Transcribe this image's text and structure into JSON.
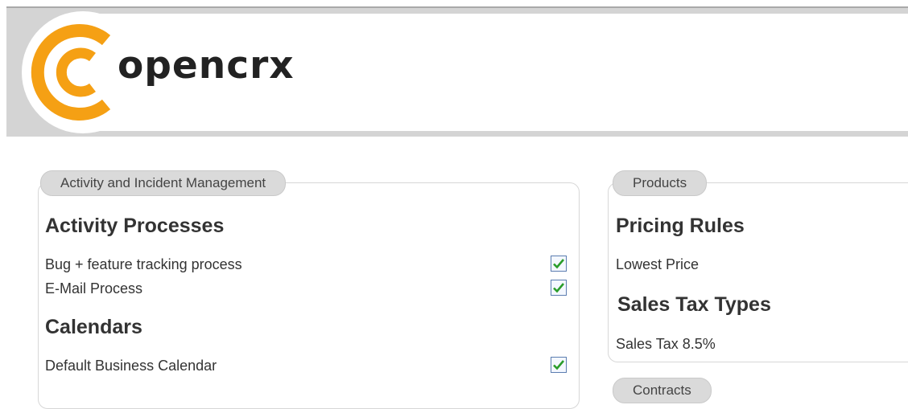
{
  "header": {
    "logo_text": "opencrx",
    "colors": {
      "brand": "#f5a014",
      "header_bg": "#d4d4d4"
    },
    "logo_icon": "opencrx-c-logo-icon"
  },
  "panels": {
    "activity": {
      "tab": "Activity and Incident Management",
      "sections": [
        {
          "title": "Activity Processes",
          "items": [
            {
              "label": "Bug + feature tracking process",
              "checked": true
            },
            {
              "label": "E-Mail Process",
              "checked": true
            }
          ]
        },
        {
          "title": "Calendars",
          "items": [
            {
              "label": "Default Business Calendar",
              "checked": true
            }
          ]
        }
      ]
    },
    "products": {
      "tab": "Products",
      "sections": [
        {
          "title": "Pricing Rules",
          "items": [
            {
              "label": "Lowest Price"
            }
          ]
        },
        {
          "title": "Sales Tax Types",
          "items": [
            {
              "label": "Sales Tax 8.5%"
            }
          ]
        }
      ]
    },
    "contracts": {
      "tab": "Contracts"
    }
  },
  "icons": {
    "checkbox": "checkmark-icon"
  }
}
